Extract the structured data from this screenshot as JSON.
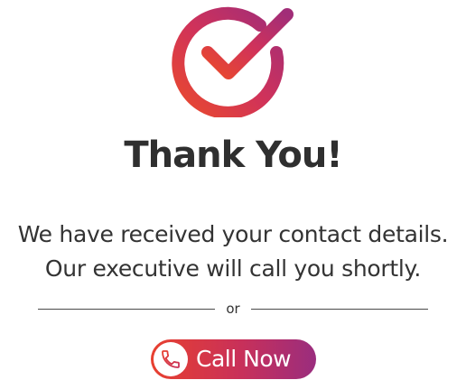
{
  "icons": {
    "success": "check-circle-icon",
    "phone": "phone-icon"
  },
  "colors": {
    "gradient_start": "#e8402f",
    "gradient_mid": "#c8305a",
    "gradient_end": "#9a2d7e",
    "text": "#333333",
    "title": "#2f2f2f"
  },
  "confirmation": {
    "title": "Thank You!",
    "message_line1": "We have received your contact details.",
    "message_line2": "Our executive will call you shortly.",
    "divider_text": "or"
  },
  "cta": {
    "call_label": "Call Now"
  }
}
